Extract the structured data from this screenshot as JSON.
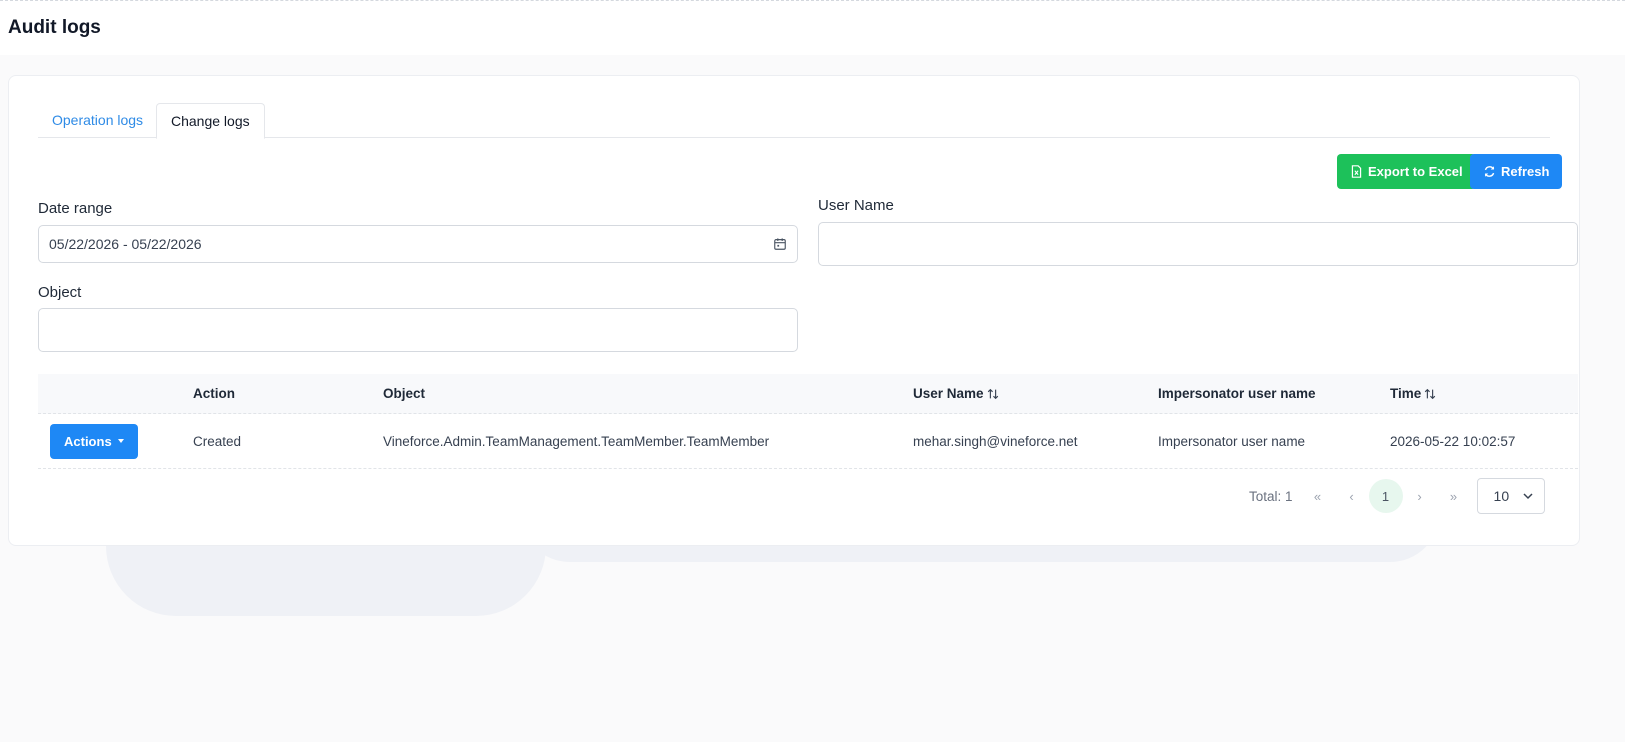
{
  "page": {
    "title": "Audit logs"
  },
  "tabs": [
    {
      "label": "Operation logs",
      "active": false
    },
    {
      "label": "Change logs",
      "active": true
    }
  ],
  "toolbar": {
    "export_label": "Export to Excel",
    "refresh_label": "Refresh",
    "export_icon": "excel-file-icon",
    "refresh_icon": "refresh-icon"
  },
  "filters": {
    "date_range": {
      "label": "Date range",
      "value": "05/22/2026 - 05/22/2026",
      "icon": "calendar-icon"
    },
    "user_name": {
      "label": "User Name",
      "value": ""
    },
    "object": {
      "label": "Object",
      "value": ""
    }
  },
  "table": {
    "headers": {
      "actions": "",
      "action": "Action",
      "object": "Object",
      "user_name": "User Name",
      "impersonator": "Impersonator user name",
      "time": "Time"
    },
    "rows": [
      {
        "actions_label": "Actions",
        "action": "Created",
        "object": "Vineforce.Admin.TeamManagement.TeamMember.TeamMember",
        "user_name": "mehar.singh@vineforce.net",
        "impersonator": "Impersonator user name",
        "time": "2026-05-22 10:02:57"
      }
    ]
  },
  "pagination": {
    "total_label": "Total: 1",
    "first": "«",
    "prev": "‹",
    "current_page": "1",
    "next": "›",
    "last": "»",
    "page_size": "10"
  },
  "colors": {
    "primary": "#1e88f5",
    "success": "#1dc15a",
    "link": "#2f8be6"
  }
}
